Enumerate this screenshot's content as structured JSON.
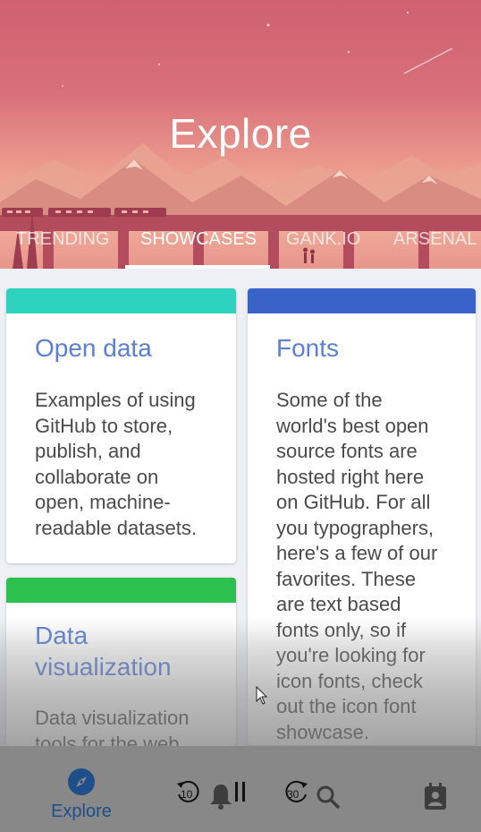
{
  "header": {
    "title": "Explore"
  },
  "tabs": [
    {
      "label": "TRENDING",
      "active": false
    },
    {
      "label": "SHOWCASES",
      "active": true
    },
    {
      "label": "GANK.IO",
      "active": false
    },
    {
      "label": "ARSENAL",
      "active": false
    }
  ],
  "cards": [
    {
      "title": "Open data",
      "description_lines": [
        "Examples of using",
        "GitHub to store,",
        "publish, and",
        "collaborate on",
        "open, machine-",
        "readable datasets."
      ],
      "strip_color": "#2ed3c0"
    },
    {
      "title": "Fonts",
      "description_lines": [
        "Some of the",
        "world's best open",
        "source fonts are",
        "hosted right here",
        "on GitHub. For all",
        "you typographers,",
        "here's a few of our",
        "favorites. These",
        "are text based",
        "fonts only, so if",
        "you're looking for",
        "icon fonts, check",
        "out the icon font",
        "showcase."
      ],
      "strip_color": "#3a63c9"
    },
    {
      "title_lines": [
        "Data",
        "visualization"
      ],
      "description_lines": [
        "Data visualization",
        "tools for the web."
      ],
      "strip_color": "#2cc14e"
    }
  ],
  "bottom_nav": {
    "explore_label": "Explore",
    "accent_color": "#1f4f8a"
  },
  "media_controls": {
    "rewind_seconds": "10",
    "forward_seconds": "30"
  }
}
